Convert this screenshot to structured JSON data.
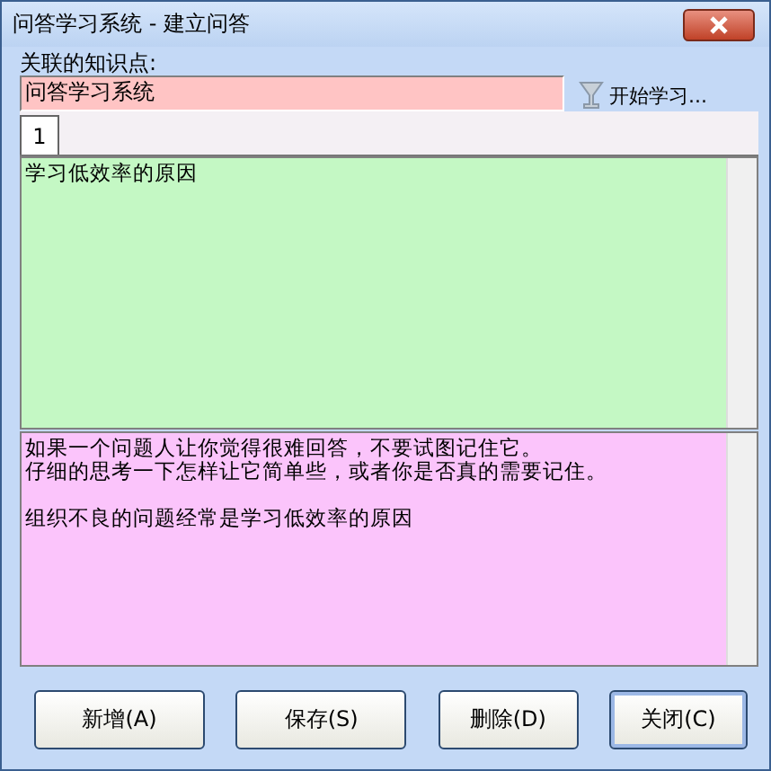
{
  "window": {
    "title": "问答学习系统 - 建立问答"
  },
  "knowledge_point": {
    "label": "关联的知识点:",
    "value": "问答学习系统"
  },
  "start_button": {
    "label": "开始学习..."
  },
  "tabs": [
    {
      "label": "1",
      "selected": true
    }
  ],
  "question": {
    "value": "学习低效率的原因"
  },
  "answer": {
    "paragraphs": [
      [
        "如果一个问题人让你觉得很难回答，不要试图记住它。",
        "仔细的思考一下怎样让它简单些，或者你是否真的需要记住。"
      ],
      [
        "组织不良的问题经常是学习低效率的原因"
      ]
    ]
  },
  "buttons": [
    {
      "label": "新增(A)",
      "focused": false
    },
    {
      "label": "保存(S)",
      "focused": false
    },
    {
      "label": "删除(D)",
      "focused": false
    },
    {
      "label": "关闭(C)",
      "focused": true
    }
  ]
}
